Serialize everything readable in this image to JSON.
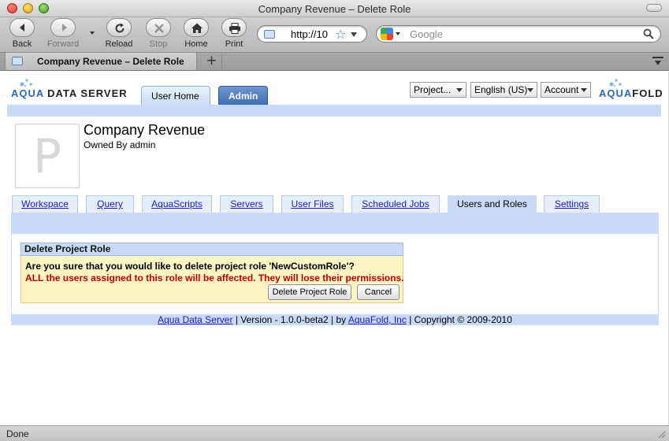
{
  "window": {
    "title": "Company Revenue – Delete Role"
  },
  "toolbar": {
    "back_label": "Back",
    "forward_label": "Forward",
    "reload_label": "Reload",
    "stop_label": "Stop",
    "home_label": "Home",
    "print_label": "Print",
    "url": "http://10",
    "search_placeholder": "Google"
  },
  "browser_tab": {
    "title": "Company Revenue – Delete Role",
    "new_tab": "+"
  },
  "header": {
    "logo_left_1": "AQUA",
    "logo_left_2": "DATA SERVER",
    "logo_right_1": "AQUA",
    "logo_right_2": "FOLD",
    "main_tabs": [
      {
        "label": "User Home",
        "active": true
      },
      {
        "label": "Admin",
        "active": false
      }
    ],
    "project_select": "Project...",
    "language_select": "English (US)",
    "account_select": "Account"
  },
  "project": {
    "icon_letter": "P",
    "title": "Company Revenue",
    "owner": "Owned By admin"
  },
  "project_tabs": [
    {
      "label": "Workspace",
      "active": false
    },
    {
      "label": "Query",
      "active": false
    },
    {
      "label": "AquaScripts",
      "active": false
    },
    {
      "label": "Servers",
      "active": false
    },
    {
      "label": "User Files",
      "active": false
    },
    {
      "label": "Scheduled Jobs",
      "active": false
    },
    {
      "label": "Users and Roles",
      "active": true
    },
    {
      "label": "Settings",
      "active": false
    }
  ],
  "dialog": {
    "title": "Delete Project Role",
    "question": "Are you sure that you would like to delete project role 'NewCustomRole'?",
    "warning": "ALL the users assigned to this role will be affected. They will lose their permissions.",
    "delete_button": "Delete Project Role",
    "cancel_button": "Cancel"
  },
  "footer": {
    "product_link": "Aqua Data Server",
    "version": " | Version - 1.0.0-beta2 | by ",
    "company_link": "AquaFold, Inc",
    "copyright": " | Copyright © 2009-2010"
  },
  "status": {
    "text": "Done"
  },
  "colors": {
    "band": "#c8daf5",
    "link": "#1a1acc",
    "warning": "#c00000",
    "dialog_bg": "#fdf4c4",
    "admin_tab": "#3d6db0"
  }
}
